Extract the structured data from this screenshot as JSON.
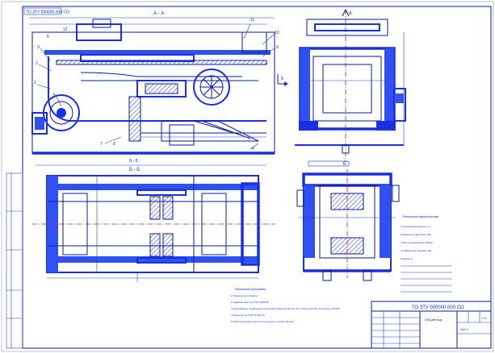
{
  "stamp_code": "ТО ЗТУ 000000.000 СО",
  "title_block": {
    "designation": "ТО ЗТУ 000000.000 СО",
    "name": "Общий вид",
    "material": "",
    "scale": "1:10",
    "sheet": "Лист 1"
  },
  "views": {
    "section_aa": "А - А",
    "section_bb": "Б - Б",
    "view_b": "Б",
    "view_a": "А",
    "view_b_arrow": "Б"
  },
  "callouts": [
    "1",
    "2",
    "3",
    "4",
    "5",
    "6",
    "7",
    "8",
    "9",
    "10",
    "11",
    "12"
  ],
  "notes_left": {
    "heading": "Технические требования",
    "lines": [
      "1 Размеры для справок.",
      "2 Сварные швы по ГОСТ 5264-80.",
      "3 Неуказанные предельные отклонения размеров валов h14, отверстий H14, остальных ±IT14/2.",
      "4 Покрытие по ГОСТ 9.032-74.",
      "5 Обкатать машину на холостом ходу в течение 30 мин."
    ]
  },
  "notes_right": {
    "heading": "Техническая характеристика",
    "lines": [
      "1 Производительность, т/ч",
      "2 Мощность двигателя, кВт",
      "3 Частота вращения, об/мин",
      "4 Габаритные размеры, мм",
      "5 Масса, кг"
    ]
  },
  "colors": {
    "primary": "#1a30e0",
    "dark": "#0a1aa0",
    "axis": "#d02020",
    "paper": "#ffffff"
  }
}
